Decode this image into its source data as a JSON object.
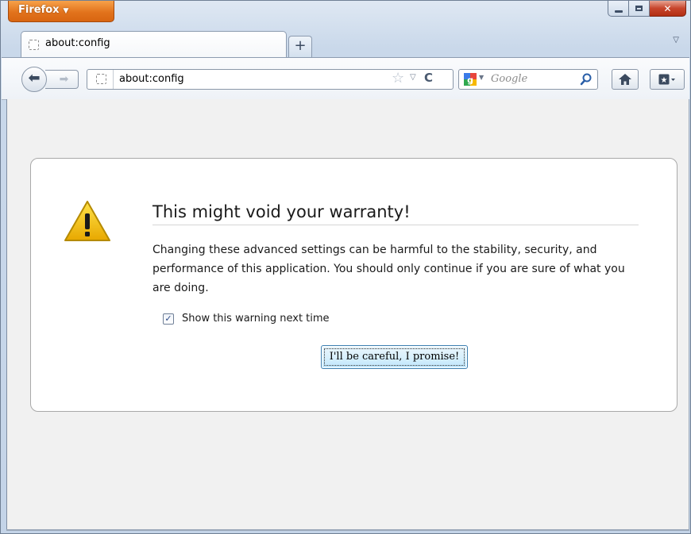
{
  "app_menu": {
    "label": "Firefox"
  },
  "tab": {
    "title": "about:config"
  },
  "navbar": {
    "url": "about:config",
    "search_placeholder": "Google"
  },
  "warning": {
    "title": "This might void your warranty!",
    "body": "Changing these advanced settings can be harmful to the stability, security, and performance of this application. You should only continue if you are sure of what you are doing.",
    "checkbox_label": "Show this warning next time",
    "checkbox_checked": true,
    "button_label": "I'll be careful, I promise!"
  },
  "colors": {
    "app_button": "#e2731c",
    "close_button": "#c7452c",
    "content_bg": "#f1f1f1",
    "warning_yellow": "#f5c400"
  },
  "icons": [
    "back-icon",
    "forward-icon",
    "star-icon",
    "reload-icon",
    "google-icon",
    "search-icon",
    "home-icon",
    "bookmarks-icon",
    "warning-icon"
  ]
}
